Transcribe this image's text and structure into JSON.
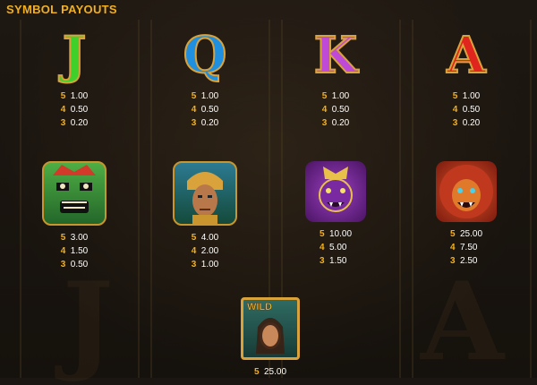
{
  "title": "SYMBOL PAYOUTS",
  "symbols": [
    {
      "name": "J",
      "icon": "letter-j-icon",
      "color": "#3fcf2c",
      "payouts": [
        {
          "count": "5",
          "value": "1.00"
        },
        {
          "count": "4",
          "value": "0.50"
        },
        {
          "count": "3",
          "value": "0.20"
        }
      ]
    },
    {
      "name": "Q",
      "icon": "letter-q-icon",
      "color": "#1f8fe0",
      "payouts": [
        {
          "count": "5",
          "value": "1.00"
        },
        {
          "count": "4",
          "value": "0.50"
        },
        {
          "count": "3",
          "value": "0.20"
        }
      ]
    },
    {
      "name": "K",
      "icon": "letter-k-icon",
      "color": "#c04ad8",
      "payouts": [
        {
          "count": "5",
          "value": "1.00"
        },
        {
          "count": "4",
          "value": "0.50"
        },
        {
          "count": "3",
          "value": "0.20"
        }
      ]
    },
    {
      "name": "A",
      "icon": "letter-a-icon",
      "color": "#e0241e",
      "payouts": [
        {
          "count": "5",
          "value": "1.00"
        },
        {
          "count": "4",
          "value": "0.50"
        },
        {
          "count": "3",
          "value": "0.20"
        }
      ]
    },
    {
      "name": "green-mask",
      "icon": "green-tribal-mask-icon",
      "color": "#3f9a3a",
      "payouts": [
        {
          "count": "5",
          "value": "3.00"
        },
        {
          "count": "4",
          "value": "1.50"
        },
        {
          "count": "3",
          "value": "0.50"
        }
      ]
    },
    {
      "name": "warrior",
      "icon": "jaguar-warrior-icon",
      "color": "#2a7a55",
      "payouts": [
        {
          "count": "5",
          "value": "4.00"
        },
        {
          "count": "4",
          "value": "2.00"
        },
        {
          "count": "3",
          "value": "1.00"
        }
      ]
    },
    {
      "name": "purple-jaguar",
      "icon": "purple-jaguar-mask-icon",
      "color": "#8a2fb0",
      "payouts": [
        {
          "count": "5",
          "value": "10.00"
        },
        {
          "count": "4",
          "value": "5.00"
        },
        {
          "count": "3",
          "value": "1.50"
        }
      ]
    },
    {
      "name": "red-lion",
      "icon": "red-lion-mask-icon",
      "color": "#c0391e",
      "payouts": [
        {
          "count": "5",
          "value": "25.00"
        },
        {
          "count": "4",
          "value": "7.50"
        },
        {
          "count": "3",
          "value": "2.50"
        }
      ]
    }
  ],
  "wild": {
    "label": "WILD",
    "icon": "wild-woman-icon",
    "payouts": [
      {
        "count": "5",
        "value": "25.00"
      }
    ]
  }
}
